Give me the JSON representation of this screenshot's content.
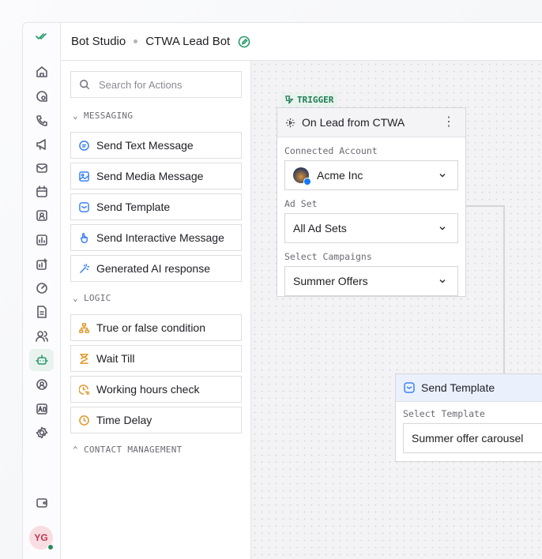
{
  "header": {
    "app": "Bot Studio",
    "bot_name": "CTWA Lead Bot"
  },
  "sidebar": {
    "items": [
      "home",
      "chats",
      "calls",
      "campaigns",
      "inbox",
      "calendar",
      "contacts",
      "reports",
      "analytics",
      "speedometer",
      "documents",
      "team",
      "bot-studio",
      "automations",
      "ads",
      "settings"
    ],
    "active": "bot-studio",
    "bottom": "wallet",
    "avatar": "YG",
    "status_color": "#2b8a5e"
  },
  "panel": {
    "search_placeholder": "Search for Actions",
    "messaging_title": "MESSAGING",
    "messaging": [
      "Send Text Message",
      "Send Media Message",
      "Send Template",
      "Send Interactive Message",
      "Generated AI response"
    ],
    "logic_title": "LOGIC",
    "logic": [
      "True or false condition",
      "Wait Till",
      "Working hours check",
      "Time Delay"
    ],
    "contact_title": "CONTACT MANAGEMENT"
  },
  "canvas": {
    "trigger_tag": "TRIGGER",
    "trigger": {
      "title": "On Lead from CTWA",
      "account_label": "Connected Account",
      "account": "Acme Inc",
      "adset_label": "Ad Set",
      "adset": "All Ad Sets",
      "campaign_label": "Select Campaigns",
      "campaign": "Summer Offers"
    },
    "template_node": {
      "title": "Send Template",
      "label": "Select Template",
      "value": "Summer offer carousel"
    }
  },
  "colors": {
    "accent": "#2a9a6a",
    "message_icons": "#3b82f6",
    "logic_icons": "#e0982a"
  }
}
